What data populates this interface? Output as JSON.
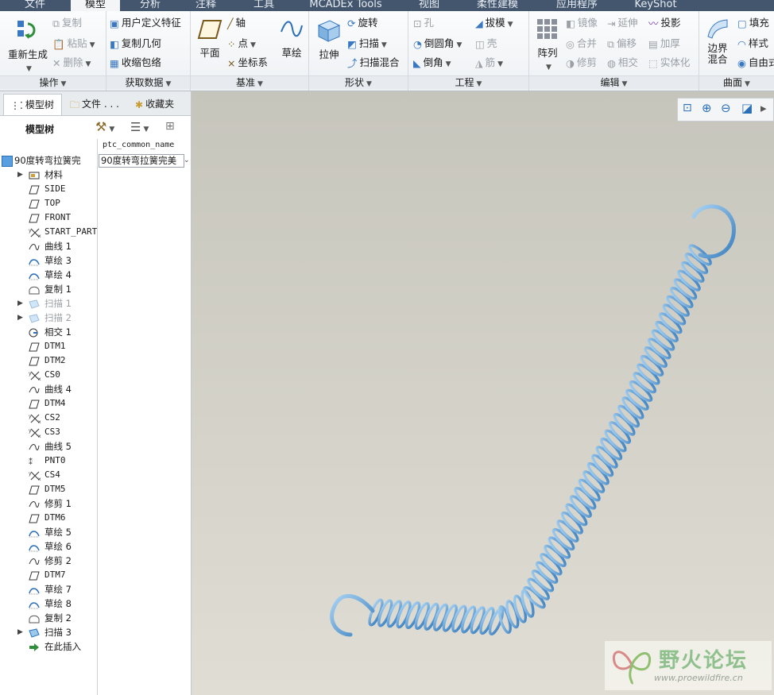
{
  "menu": {
    "tabs": [
      "文件",
      "模型",
      "分析",
      "注释",
      "工具",
      "MCADEx Tools",
      "视图",
      "柔性建模",
      "应用程序",
      "KeyShot"
    ],
    "active": "模型"
  },
  "ribbon": {
    "operations": {
      "label": "操作",
      "regenerate": "重新生成",
      "copy": "复制",
      "paste": "粘贴",
      "delete": "删除"
    },
    "get_data": {
      "label": "获取数据",
      "udf": "用户定义特征",
      "copy_geom": "复制几何",
      "shrinkwrap": "收缩包络"
    },
    "datum": {
      "label": "基准",
      "plane": "平面",
      "axis": "轴",
      "point": "点",
      "csys": "坐标系",
      "sketch": "草绘"
    },
    "shapes": {
      "label": "形状",
      "extrude": "拉伸",
      "revolve": "旋转",
      "sweep": "扫描",
      "swept_blend": "扫描混合"
    },
    "engineering": {
      "label": "工程",
      "hole": "孔",
      "round": "倒圆角",
      "chamfer": "倒角",
      "draft": "拔模",
      "shell": "壳",
      "rib": "筋"
    },
    "editing": {
      "label": "编辑",
      "pattern": "阵列",
      "mirror": "镜像",
      "merge": "合并",
      "trim": "修剪",
      "extend": "延伸",
      "offset": "偏移",
      "intersect": "相交",
      "project": "投影",
      "thicken": "加厚",
      "solidify": "实体化"
    },
    "surfaces": {
      "label": "曲面",
      "boundary_blend": "边界混合",
      "fill": "填充",
      "style": "样式",
      "freestyle": "自由式"
    }
  },
  "panel": {
    "tabs": [
      "模型树",
      "文件 . . .",
      "收藏夹"
    ],
    "tree_title": "模型树",
    "column_header": "ptc_common_name",
    "root_name": "90度转弯拉簧完",
    "root_value": "90度转弯拉簧完美",
    "nodes": [
      {
        "label": "材料",
        "icon": "material-icon",
        "expandable": true
      },
      {
        "label": "SIDE",
        "icon": "datum-plane-icon"
      },
      {
        "label": "TOP",
        "icon": "datum-plane-icon"
      },
      {
        "label": "FRONT",
        "icon": "datum-plane-icon"
      },
      {
        "label": "START_PART",
        "icon": "csys-icon"
      },
      {
        "label": "曲线 1",
        "icon": "curve-icon"
      },
      {
        "label": "草绘 3",
        "icon": "sketch-icon"
      },
      {
        "label": "草绘 4",
        "icon": "sketch-icon"
      },
      {
        "label": "复制 1",
        "icon": "copy-icon"
      },
      {
        "label": "扫描 1",
        "icon": "sweep-icon",
        "expandable": true,
        "suppressed": true
      },
      {
        "label": "扫描 2",
        "icon": "sweep-icon",
        "expandable": true,
        "suppressed": true
      },
      {
        "label": "相交 1",
        "icon": "intersect-icon"
      },
      {
        "label": "DTM1",
        "icon": "datum-plane-icon"
      },
      {
        "label": "DTM2",
        "icon": "datum-plane-icon"
      },
      {
        "label": "CS0",
        "icon": "csys-icon"
      },
      {
        "label": "曲线 4",
        "icon": "curve-icon"
      },
      {
        "label": "DTM4",
        "icon": "datum-plane-icon"
      },
      {
        "label": "CS2",
        "icon": "csys-icon"
      },
      {
        "label": "CS3",
        "icon": "csys-icon"
      },
      {
        "label": "曲线 5",
        "icon": "curve-icon"
      },
      {
        "label": "PNT0",
        "icon": "point-icon"
      },
      {
        "label": "CS4",
        "icon": "csys-icon"
      },
      {
        "label": "DTM5",
        "icon": "datum-plane-icon"
      },
      {
        "label": "修剪 1",
        "icon": "curve-icon"
      },
      {
        "label": "DTM6",
        "icon": "datum-plane-icon"
      },
      {
        "label": "草绘 5",
        "icon": "sketch-icon"
      },
      {
        "label": "草绘 6",
        "icon": "sketch-icon"
      },
      {
        "label": "修剪 2",
        "icon": "curve-icon"
      },
      {
        "label": "DTM7",
        "icon": "datum-plane-icon"
      },
      {
        "label": "草绘 7",
        "icon": "sketch-icon"
      },
      {
        "label": "草绘 8",
        "icon": "sketch-icon"
      },
      {
        "label": "复制 2",
        "icon": "copy-icon"
      },
      {
        "label": "扫描 3",
        "icon": "sweep-icon",
        "expandable": true
      },
      {
        "label": "在此插入",
        "icon": "insert-here-icon"
      }
    ]
  },
  "watermark": {
    "title": "野火论坛",
    "url": "www.proewildfire.cn"
  },
  "colors": {
    "menubar": "#44566d",
    "spring": "#4e8fc9",
    "spring_highlight": "#a9d3f3"
  }
}
